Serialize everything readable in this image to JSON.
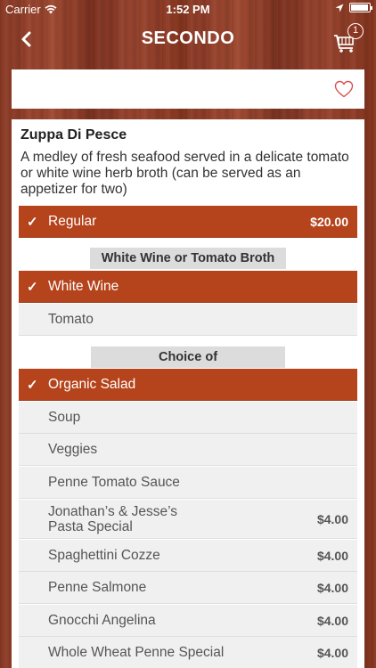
{
  "status_bar": {
    "carrier": "Carrier",
    "time": "1:52 PM"
  },
  "nav": {
    "title": "SECONDO",
    "cart_count": "1"
  },
  "item": {
    "name": "Zuppa Di Pesce",
    "description": "A medley of fresh seafood served in a delicate tomato or white wine herb broth (can be served as an appetizer for two)"
  },
  "size_option": {
    "label": "Regular",
    "price": "$20.00",
    "selected": true
  },
  "broth_section": {
    "header": "White Wine or Tomato Broth",
    "options": [
      {
        "label": "White Wine",
        "price": "",
        "selected": true
      },
      {
        "label": "Tomato",
        "price": "",
        "selected": false
      }
    ]
  },
  "choice_section": {
    "header": "Choice of",
    "options": [
      {
        "label": "Organic Salad",
        "price": "",
        "selected": true
      },
      {
        "label": "Soup",
        "price": "",
        "selected": false
      },
      {
        "label": "Veggies",
        "price": "",
        "selected": false
      },
      {
        "label": "Penne Tomato Sauce",
        "price": "",
        "selected": false
      },
      {
        "label": "Jonathan’s & Jesse’s Pasta Special",
        "price": "$4.00",
        "selected": false
      },
      {
        "label": "Spaghettini Cozze",
        "price": "$4.00",
        "selected": false
      },
      {
        "label": "Penne Salmone",
        "price": "$4.00",
        "selected": false
      },
      {
        "label": "Gnocchi Angelina",
        "price": "$4.00",
        "selected": false
      },
      {
        "label": "Whole Wheat Penne Special",
        "price": "$4.00",
        "selected": false
      }
    ]
  },
  "icons": {
    "check": "✓",
    "back": "chevron-left-icon",
    "cart": "cart-icon",
    "favorite": "heart-icon"
  },
  "colors": {
    "accent": "#b5431c",
    "heart": "#d9534f"
  }
}
